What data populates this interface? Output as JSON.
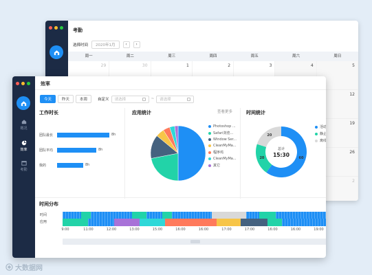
{
  "colors": {
    "accent": "#1e8ff5",
    "sidebar": "#1c2b45"
  },
  "back_window": {
    "title": "考勤",
    "filter_label": "选择时间",
    "filter_value": "2020年1月",
    "prev_icon": "chevron-left-icon",
    "next_icon": "chevron-right-icon",
    "weekdays": [
      "周一",
      "周二",
      "周三",
      "周四",
      "周五",
      "周六",
      "周日"
    ],
    "weeks": [
      [
        {
          "d": "29",
          "muted": true
        },
        {
          "d": "30",
          "muted": true
        },
        {
          "d": "1"
        },
        {
          "d": "2"
        },
        {
          "d": "3"
        },
        {
          "d": "4",
          "wkend": true
        },
        {
          "d": "5",
          "wkend": true
        }
      ],
      [
        {
          "d": ""
        },
        {
          "d": ""
        },
        {
          "d": ""
        },
        {
          "d": ""
        },
        {
          "d": ""
        },
        {
          "d": "",
          "wkend": true
        },
        {
          "d": "12",
          "wkend": true
        }
      ],
      [
        {
          "d": ""
        },
        {
          "d": ""
        },
        {
          "d": ""
        },
        {
          "d": ""
        },
        {
          "d": ""
        },
        {
          "d": "",
          "wkend": true
        },
        {
          "d": "19",
          "wkend": true
        }
      ],
      [
        {
          "d": ""
        },
        {
          "d": ""
        },
        {
          "d": ""
        },
        {
          "d": ""
        },
        {
          "d": ""
        },
        {
          "d": "",
          "wkend": true
        },
        {
          "d": "26",
          "wkend": true
        }
      ],
      [
        {
          "d": ""
        },
        {
          "d": ""
        },
        {
          "d": ""
        },
        {
          "d": ""
        },
        {
          "d": ""
        },
        {
          "d": "",
          "wkend": true
        },
        {
          "d": "2",
          "wkend": true,
          "muted": true
        }
      ]
    ]
  },
  "front_window": {
    "title": "效率",
    "nav": [
      {
        "label": "概况",
        "icon": "home-icon",
        "active": false
      },
      {
        "label": "效率",
        "icon": "pie-chart-icon",
        "active": true
      },
      {
        "label": "考勤",
        "icon": "calendar-icon",
        "active": false
      }
    ],
    "toolbar": {
      "buttons": [
        {
          "label": "今天",
          "active": true
        },
        {
          "label": "昨天",
          "active": false
        },
        {
          "label": "本周",
          "active": false
        }
      ],
      "custom_label": "自定义",
      "start_placeholder": "请选择",
      "end_placeholder": "请选择",
      "separator": "~"
    },
    "work_title": "工作时长",
    "app_title": "应用统计",
    "more_label": "查看更多",
    "time_title": "时间统计",
    "dist_title": "时间分布",
    "dist_rows": [
      "时间",
      "应用"
    ]
  },
  "chart_data": [
    {
      "type": "bar",
      "orientation": "horizontal",
      "title": "工作时长",
      "categories": [
        "团队最长",
        "团队平均",
        "我的"
      ],
      "values": [
        8,
        8,
        8
      ],
      "value_labels": [
        "8h",
        "8h",
        "8h"
      ],
      "bar_lengths_relative": [
        1.0,
        0.75,
        0.5
      ]
    },
    {
      "type": "pie",
      "title": "应用统计",
      "labels": [
        "Photoshop ...",
        "Safari浏览...",
        "Window Ser...",
        "CleanMyMa...",
        "程序坞",
        "CleanMyMa...",
        "其它"
      ],
      "values": [
        50,
        22,
        14,
        5,
        4,
        3,
        2
      ],
      "colors": [
        "#1e8ff5",
        "#22d3a8",
        "#45627f",
        "#f7c548",
        "#ff7a5c",
        "#2ed8d8",
        "#a872d8"
      ]
    },
    {
      "type": "pie",
      "subtype": "donut",
      "title": "时间统计",
      "labels": [
        "活动",
        "静止",
        "离线"
      ],
      "values": [
        60,
        20,
        20
      ],
      "colors": [
        "#1e8ff5",
        "#22d3a8",
        "#d9d9d9"
      ],
      "center_label": "总计",
      "center_value": "15:30"
    },
    {
      "type": "timeline",
      "title": "时间分布",
      "x_ticks": [
        "9:00",
        "11:00",
        "12:00",
        "13:00",
        "15:00",
        "16:00",
        "16:00",
        "17:00",
        "17:00",
        "16:00",
        "16:00",
        "19:00"
      ],
      "rows": [
        {
          "name": "时间",
          "segments": [
            {
              "w": 0.07,
              "c": "#1e8ff5"
            },
            {
              "w": 0.035,
              "c": "#22d3a8"
            },
            {
              "w": 0.155,
              "c": "#1e8ff5"
            },
            {
              "w": 0.055,
              "c": "#22d3a8"
            },
            {
              "w": 0.06,
              "c": "#1e8ff5"
            },
            {
              "w": 0.035,
              "c": "#22d3a8"
            },
            {
              "w": 0.15,
              "c": "#1e8ff5"
            },
            {
              "w": 0.13,
              "c": "#d9d9d9"
            },
            {
              "w": 0.05,
              "c": "#1e8ff5"
            },
            {
              "w": 0.06,
              "c": "#22d3a8"
            },
            {
              "w": 0.2,
              "c": "#1e8ff5"
            }
          ]
        },
        {
          "name": "应用",
          "segments": [
            {
              "w": 0.095,
              "c": "#22d3a8"
            },
            {
              "w": 0.1,
              "c": "#1e8ff5"
            },
            {
              "w": 0.095,
              "c": "#a872d8"
            },
            {
              "w": 0.095,
              "c": "#2ed8d8"
            },
            {
              "w": 0.195,
              "c": "#ff7a5c"
            },
            {
              "w": 0.09,
              "c": "#f7c548"
            },
            {
              "w": 0.1,
              "c": "#45627f"
            },
            {
              "w": 0.055,
              "c": "#22d3a8"
            },
            {
              "w": 0.175,
              "c": "#1e8ff5"
            }
          ]
        }
      ]
    }
  ],
  "watermark": "大数据网"
}
